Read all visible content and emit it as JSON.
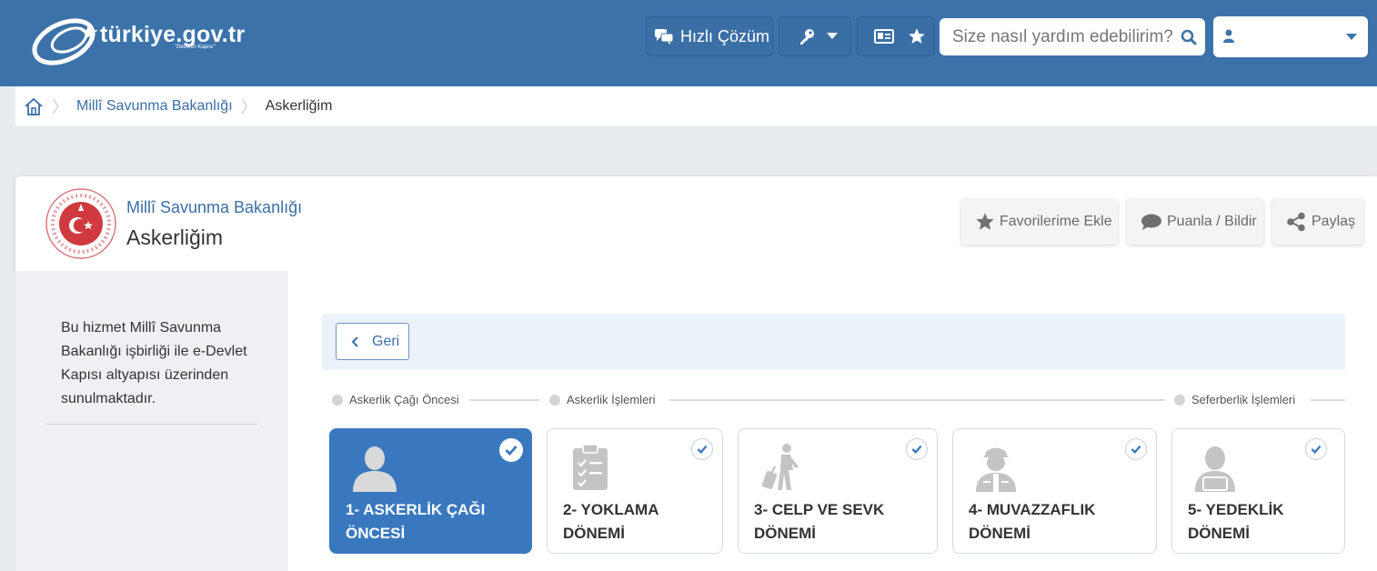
{
  "header": {
    "logo_text": "türkiye.gov.tr",
    "logo_tagline": "\"Devletin Kapısı\"",
    "quick_solution_label": "Hızlı Çözüm",
    "search_placeholder": "Size nasıl yardım edebilirim?",
    "user_name": ""
  },
  "breadcrumb": {
    "items": [
      "Millî Savunma Bakanlığı",
      "Askerliğim"
    ]
  },
  "service": {
    "institution": "Millî Savunma Bakanlığı",
    "title": "Askerliğim",
    "actions": {
      "favorite": "Favorilerime Ekle",
      "rate": "Puanla / Bildir",
      "share": "Paylaş"
    }
  },
  "sidebar": {
    "info_text": "Bu hizmet Millî Savunma Bakanlığı işbirliği ile e-Devlet Kapısı altyapısı üzerinden sunulmaktadır."
  },
  "main": {
    "back_label": "Geri",
    "stages": [
      "Askerlik Çağı Öncesi",
      "Askerlik İşlemleri",
      "Seferberlik İşlemleri"
    ],
    "cards": [
      {
        "line1": "1- ASKERLİK ÇAĞI",
        "line2": "ÖNCESİ",
        "icon": "person-icon",
        "active": true
      },
      {
        "line1": "2- YOKLAMA",
        "line2": "DÖNEMİ",
        "icon": "clipboard-check-icon",
        "active": false
      },
      {
        "line1": "3- CELP VE SEVK",
        "line2": "DÖNEMİ",
        "icon": "traveler-icon",
        "active": false
      },
      {
        "line1": "4- MUVAZZAFLIK",
        "line2": "DÖNEMİ",
        "icon": "soldier-icon",
        "active": false
      },
      {
        "line1": "5- YEDEKLİK",
        "line2": "DÖNEMİ",
        "icon": "reserve-person-icon",
        "active": false
      }
    ]
  },
  "colors": {
    "header_bg": "#3c72aa",
    "active_card": "#3978be",
    "link": "#3b6ea7"
  }
}
